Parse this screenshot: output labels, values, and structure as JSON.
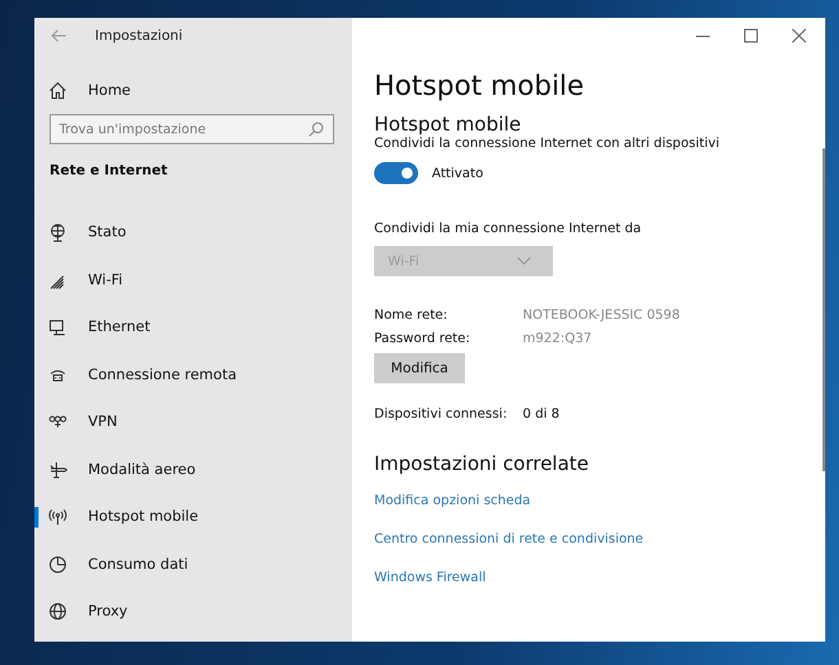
{
  "window": {
    "title": "Impostazioni"
  },
  "sidebar": {
    "home": "Home",
    "search": {
      "placeholder": "Trova un'impostazione"
    },
    "section": "Rete e Internet",
    "items": [
      {
        "label": "Stato",
        "selected": false
      },
      {
        "label": "Wi-Fi",
        "selected": false
      },
      {
        "label": "Ethernet",
        "selected": false
      },
      {
        "label": "Connessione remota",
        "selected": false
      },
      {
        "label": "VPN",
        "selected": false
      },
      {
        "label": "Modalità aereo",
        "selected": false
      },
      {
        "label": "Hotspot mobile",
        "selected": true
      },
      {
        "label": "Consumo dati",
        "selected": false
      },
      {
        "label": "Proxy",
        "selected": false
      }
    ]
  },
  "main": {
    "title": "Hotspot mobile",
    "heading": "Hotspot mobile",
    "description": "Condividi la connessione Internet con altri dispositivi",
    "toggle": {
      "on": true,
      "label": "Attivato"
    },
    "share_from": {
      "label": "Condividi la mia connessione Internet da",
      "value": "Wi-Fi",
      "disabled": true
    },
    "details": [
      {
        "label": "Nome rete:",
        "value": "NOTEBOOK-JESSIC 0598"
      },
      {
        "label": "Password rete:",
        "value": "m922:Q37"
      }
    ],
    "edit_button": "Modifica",
    "connected": {
      "label": "Dispositivi connessi:",
      "value": "0 di 8"
    },
    "related": {
      "heading": "Impostazioni correlate",
      "links": [
        "Modifica opzioni scheda",
        "Centro connessioni di rete e condivisione",
        "Windows Firewall"
      ]
    }
  }
}
